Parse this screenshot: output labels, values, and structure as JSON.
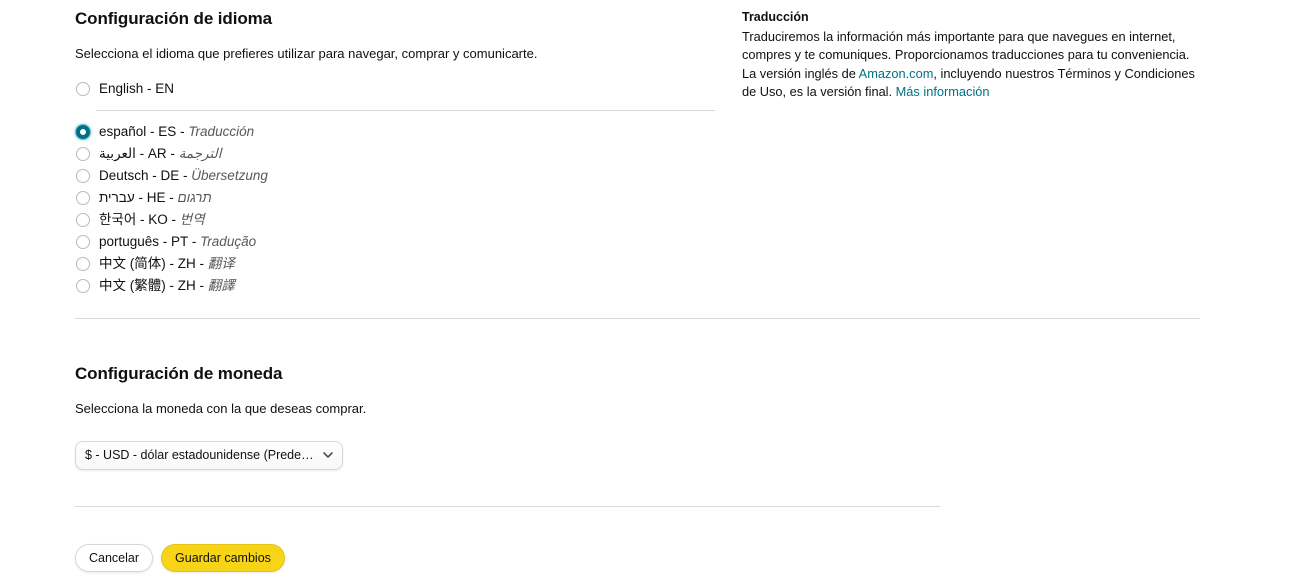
{
  "language_section": {
    "title": "Configuración de idioma",
    "subtitle": "Selecciona el idioma que prefieres utilizar para navegar, comprar y comunicarte.",
    "options": [
      {
        "name": "English",
        "code": "EN",
        "translation": "",
        "selected": false,
        "divider_below": true
      },
      {
        "name": "español",
        "code": "ES",
        "translation": "Traducción",
        "selected": true,
        "divider_below": false
      },
      {
        "name": "العربية",
        "code": "AR",
        "translation": "الترجمة",
        "selected": false,
        "divider_below": false
      },
      {
        "name": "Deutsch",
        "code": "DE",
        "translation": "Übersetzung",
        "selected": false,
        "divider_below": false
      },
      {
        "name": "עברית",
        "code": "HE",
        "translation": "תרגום",
        "selected": false,
        "divider_below": false
      },
      {
        "name": "한국어",
        "code": "KO",
        "translation": "번역",
        "selected": false,
        "divider_below": false
      },
      {
        "name": "português",
        "code": "PT",
        "translation": "Tradução",
        "selected": false,
        "divider_below": false
      },
      {
        "name": "中文 (简体)",
        "code": "ZH",
        "translation": "翻译",
        "selected": false,
        "divider_below": false
      },
      {
        "name": "中文 (繁體)",
        "code": "ZH",
        "translation": "翻譯",
        "selected": false,
        "divider_below": false
      }
    ]
  },
  "currency_section": {
    "title": "Configuración de moneda",
    "subtitle": "Selecciona la moneda con la que deseas comprar.",
    "selected_value": "$ - USD - dólar estadounidense (Predeterminado)",
    "chevron_icon": "chevron-down-icon"
  },
  "actions": {
    "cancel_label": "Cancelar",
    "save_label": "Guardar cambios"
  },
  "translation_panel": {
    "title": "Traducción",
    "paragraph_part1": "Traduciremos la información más importante para que navegues en internet, compres y te comuniques. Proporcionamos traducciones para tu conveniencia. La versión inglés de ",
    "link_amazon": "Amazon.com",
    "paragraph_part2": ", incluyendo nuestros Términos y Condiciones de Uso, es la versión final. ",
    "link_more": "Más información"
  },
  "colors": {
    "accent_teal": "#007185",
    "save_yellow": "#f7d417",
    "text": "#0f1111",
    "muted": "#565959",
    "divider": "#d5d9d9"
  }
}
